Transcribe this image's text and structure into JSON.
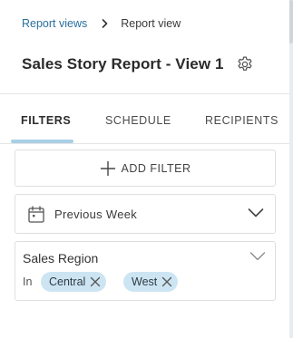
{
  "breadcrumb": {
    "parent": "Report views",
    "current": "Report view"
  },
  "page": {
    "title": "Sales Story Report - View 1"
  },
  "tabs": [
    {
      "label": "FILTERS",
      "active": true
    },
    {
      "label": "SCHEDULE",
      "active": false
    },
    {
      "label": "RECIPIENTS",
      "active": false
    }
  ],
  "filters": {
    "add_label": "ADD FILTER",
    "date_range": {
      "value": "Previous Week"
    },
    "region": {
      "label": "Sales Region",
      "operator": "In",
      "values": [
        "Central",
        "West"
      ]
    }
  },
  "icons": {
    "breadcrumb_separator": "chevron-right-icon",
    "settings": "gear-icon",
    "add": "plus-icon",
    "date": "calendar-icon",
    "expand": "chevron-down-icon",
    "remove": "close-icon"
  },
  "colors": {
    "link": "#2a6f9e",
    "tab_indicator": "#a9cfe6",
    "chip_background": "#cde5f3",
    "border": "#dcdfe2"
  }
}
